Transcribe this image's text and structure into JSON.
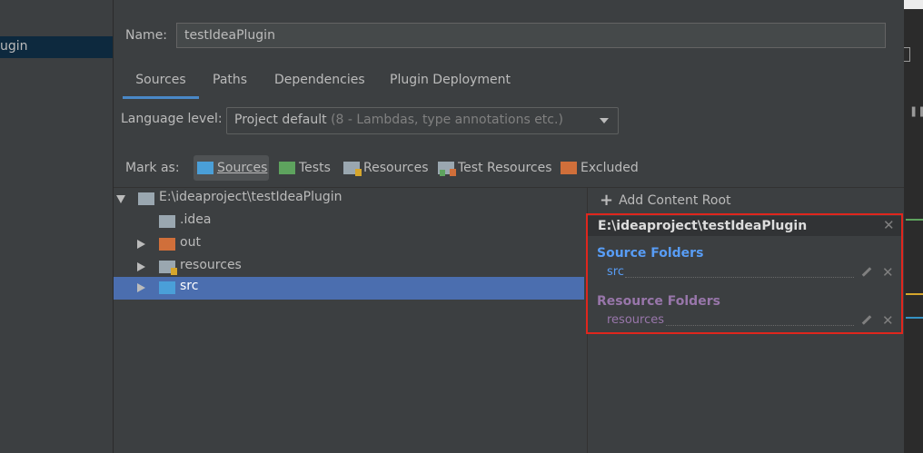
{
  "left": {
    "selected_item": "ugin"
  },
  "name": {
    "label": "Name:",
    "value": "testIdeaPlugin"
  },
  "tabs": [
    "Sources",
    "Paths",
    "Dependencies",
    "Plugin Deployment"
  ],
  "language": {
    "label": "Language level:",
    "value": "Project default",
    "hint": "(8 - Lambdas, type annotations etc.)"
  },
  "mark_as": {
    "label": "Mark as:",
    "buttons": [
      {
        "label": "Sources",
        "color": "#4a9fd8"
      },
      {
        "label": "Tests",
        "color": "#5ea35e"
      },
      {
        "label": "Resources",
        "color": "#9aa7b0"
      },
      {
        "label": "Test Resources",
        "color": "#9aa7b0"
      },
      {
        "label": "Excluded",
        "color": "#d06f3a"
      }
    ]
  },
  "tree": {
    "root": "E:\\ideaproject\\testIdeaPlugin",
    "children": [
      ".idea",
      "out",
      "resources",
      "src"
    ],
    "selected": "src"
  },
  "content_root": {
    "add_label": "Add Content Root",
    "path": "E:\\ideaproject\\testIdeaPlugin",
    "source_title": "Source Folders",
    "source_entry": "src",
    "resource_title": "Resource Folders",
    "resource_entry": "resources",
    "source_color": "#589df6",
    "resource_color": "#9876aa"
  }
}
